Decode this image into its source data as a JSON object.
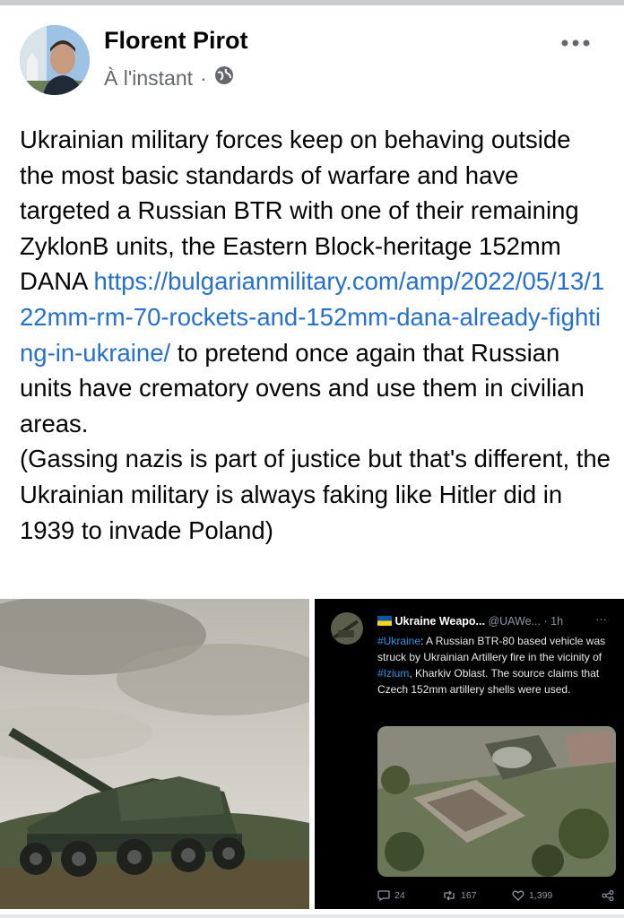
{
  "post": {
    "author": "Florent Pirot",
    "timestamp": "À l'instant",
    "separator": "·",
    "text_intro": "Ukrainian military forces keep on behaving outside the most basic standards of warfare and have targeted a Russian BTR with one of their remaining ZyklonB units, the Eastern Block-heritage 152mm DANA ",
    "link": "https://bulgarianmilitary.com/amp/2022/05/13/122mm-rm-70-rockets-and-152mm-dana-already-fighting-in-ukraine/",
    "text_after_link": " to pretend once again that Russian units have crematory ovens and use them in civilian areas.",
    "text_paren": "(Gassing nazis is part of justice but that's different, the Ukrainian military is always faking like Hitler did in 1939 to invade Poland)"
  },
  "tweet": {
    "account_name": "Ukraine Weapo...",
    "handle": "@UAWe...",
    "time": "· 1h",
    "hashtag1": "#Ukraine",
    "body1": ": A Russian BTR-80 based vehicle was struck by Ukrainian Artillery fire in the vicinity of ",
    "hashtag2": "#Izium",
    "body2": ", Kharkiv Oblast. The source claims that Czech 152mm artillery shells were used.",
    "replies": "24",
    "retweets": "167",
    "likes": "1,399"
  },
  "colors": {
    "link": "#216fdb",
    "tweet_tag": "#1d9bf0",
    "meta_grey": "#65676b"
  },
  "icons": [
    "globe-icon",
    "more-options-icon",
    "reply-icon",
    "retweet-icon",
    "like-icon",
    "share-icon"
  ]
}
